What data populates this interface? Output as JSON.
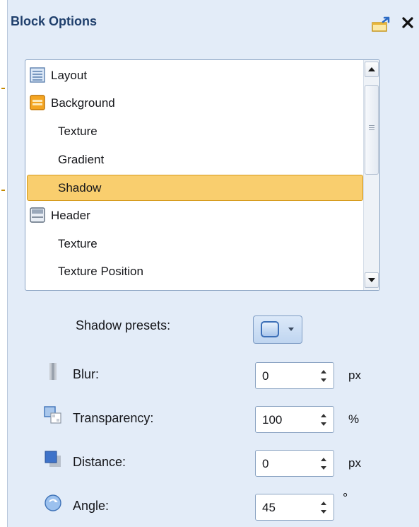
{
  "panel": {
    "title": "Block Options"
  },
  "tree": {
    "items": [
      {
        "label": "Layout",
        "icon": "layout-icon",
        "level": 0,
        "selected": false
      },
      {
        "label": "Background",
        "icon": "background-icon",
        "level": 0,
        "selected": false
      },
      {
        "label": "Texture",
        "icon": null,
        "level": 1,
        "selected": false
      },
      {
        "label": "Gradient",
        "icon": null,
        "level": 1,
        "selected": false
      },
      {
        "label": "Shadow",
        "icon": null,
        "level": 1,
        "selected": true
      },
      {
        "label": "Header",
        "icon": "header-icon",
        "level": 0,
        "selected": false
      },
      {
        "label": "Texture",
        "icon": null,
        "level": 1,
        "selected": false
      },
      {
        "label": "Texture Position",
        "icon": null,
        "level": 1,
        "selected": false
      }
    ]
  },
  "shadow": {
    "presets_label": "Shadow presets:",
    "blur": {
      "label": "Blur:",
      "value": "0",
      "unit": "px"
    },
    "transparency": {
      "label": "Transparency:",
      "value": "100",
      "unit": "%"
    },
    "distance": {
      "label": "Distance:",
      "value": "0",
      "unit": "px"
    },
    "angle": {
      "label": "Angle:",
      "value": "45",
      "unit": "°"
    }
  },
  "colors": {
    "panel_background": "#e3ecf8",
    "title_text": "#1f3f6c",
    "selection_fill": "#f9ce6e",
    "selection_border": "#d59a1c",
    "list_border": "#8aa3c2"
  }
}
